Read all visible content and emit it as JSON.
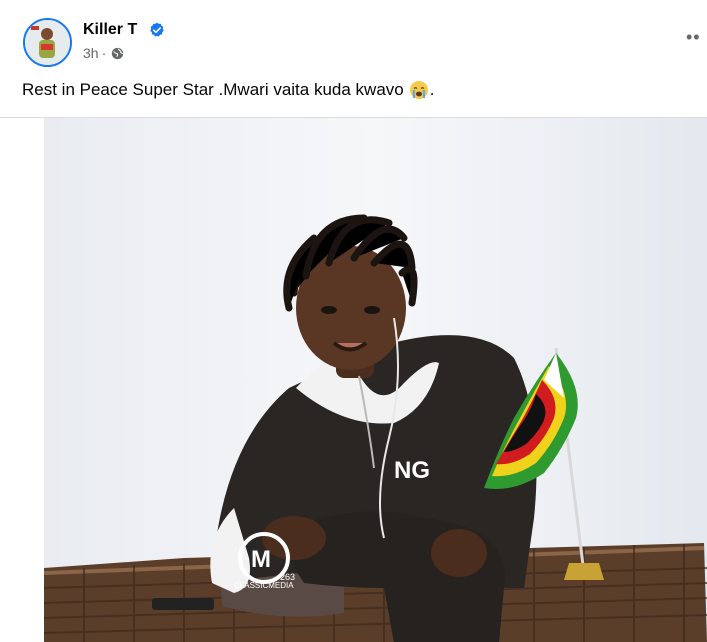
{
  "post": {
    "author": "Killer T",
    "time": "3h",
    "meta_separator": "·",
    "more_label": "••",
    "caption": "Rest in Peace Super Star .Mwari vaita kuda kwavo",
    "caption_end": "."
  },
  "photo": {
    "watermark_brand": "CLASSICMEDIA",
    "watermark_mark": "263",
    "shirt_text": "NG"
  },
  "colors": {
    "accent": "#1877f2",
    "text": "#050505",
    "secondary": "#65676b"
  },
  "icons": {
    "verified": "verified-badge-icon",
    "audience": "globe-icon",
    "more": "more-options-icon",
    "emoji": "crying-face-emoji"
  }
}
